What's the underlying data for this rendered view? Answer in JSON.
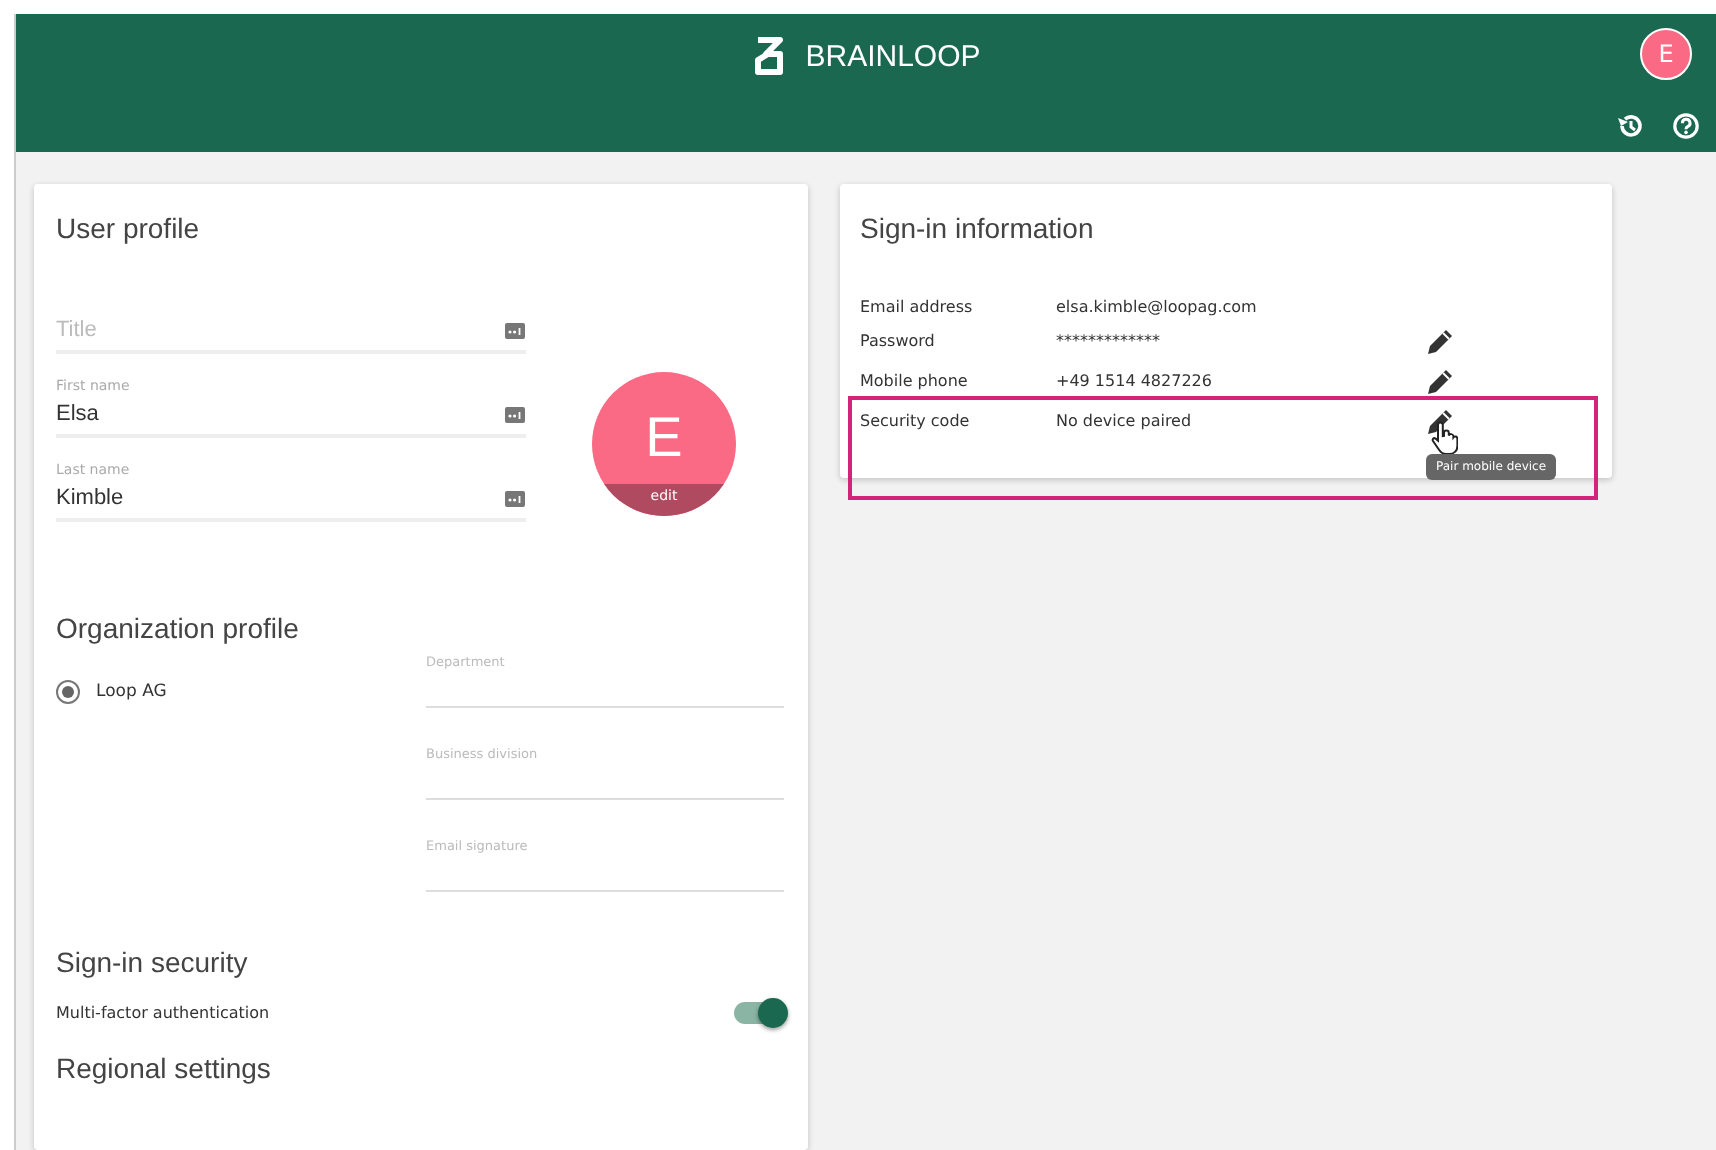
{
  "header": {
    "brand": "BRAINLOOP",
    "avatar": "E"
  },
  "user_profile": {
    "title": "User profile",
    "fields": [
      {
        "placeholder": "Title"
      },
      {
        "label": "First name",
        "value": "Elsa"
      },
      {
        "label": "Last name",
        "value": "Kimble"
      }
    ],
    "photo": {
      "initial": "E",
      "action": "edit"
    }
  },
  "organization_profile": {
    "title": "Organization profile",
    "organizations": [
      {
        "name": "Loop AG",
        "selected": true
      }
    ],
    "fields": [
      {
        "label": "Department"
      },
      {
        "label": "Business division"
      },
      {
        "label": "Email signature"
      }
    ]
  },
  "sign_in_security": {
    "title": "Sign-in security",
    "mfa": {
      "label": "Multi-factor authentication",
      "on": true
    }
  },
  "regional_settings": {
    "title": "Regional settings"
  },
  "sign_in_information": {
    "title": "Sign-in information",
    "rows": [
      {
        "label": "Email address",
        "value": "elsa.kimble@loopag.com",
        "editable": false
      },
      {
        "label": "Password",
        "value": "*************",
        "editable": true
      },
      {
        "label": "Mobile phone",
        "value": "+49 1514 4827226",
        "editable": true
      },
      {
        "label": "Security code",
        "value": "No device paired",
        "editable": true,
        "highlighted": true
      }
    ],
    "tooltip": "Pair mobile device"
  }
}
